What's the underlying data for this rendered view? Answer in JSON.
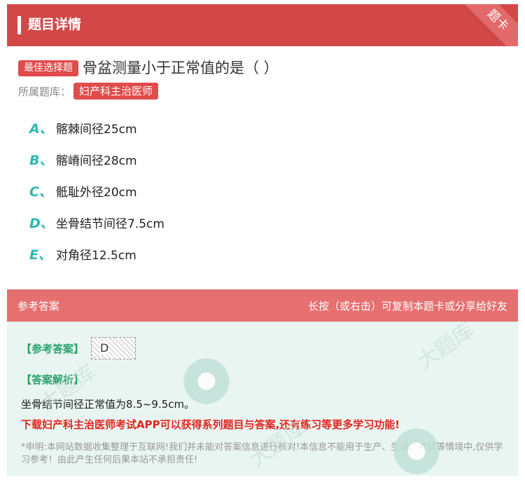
{
  "header": {
    "title": "题目详情",
    "ribbon": "题卡"
  },
  "question": {
    "type_tag": "最佳选择题",
    "text": "骨盆测量小于正常值的是（ ）",
    "category_label": "所属题库：",
    "category": "妇产科主治医师"
  },
  "options": [
    {
      "letter": "A、",
      "text": "髂棘间径25cm"
    },
    {
      "letter": "B、",
      "text": "髂嵴间径28cm"
    },
    {
      "letter": "C、",
      "text": "骶耻外径20cm"
    },
    {
      "letter": "D、",
      "text": "坐骨结节间径7.5cm"
    },
    {
      "letter": "E、",
      "text": "对角径12.5cm"
    }
  ],
  "answer": {
    "title": "参考答案",
    "hint": "长按（或右击）可复制本题卡或分享给好友",
    "ref_label": "【参考答案】",
    "ref_value": "D",
    "explain_label": "【答案解析】",
    "explain_text": "坐骨结节间径正常值为8.5~9.5cm。",
    "promo": "下载妇产科主治医师考试APP可以获得系列题目与答案,还有练习等更多学习功能!",
    "note": "*申明:本网站数据收集整理于互联网!我们并未能对答案信息进行核对!本信息不能用于生产、生活、考试等情境中,仅供学习参考！由此产生任何后果本站不承担责任!"
  },
  "watermark": {
    "text": "大题库"
  },
  "colors": {
    "brand_red": "#d24848",
    "accent_teal": "#2bb7b4",
    "answer_green": "#2aa36b",
    "promo_red": "#e0261f"
  }
}
